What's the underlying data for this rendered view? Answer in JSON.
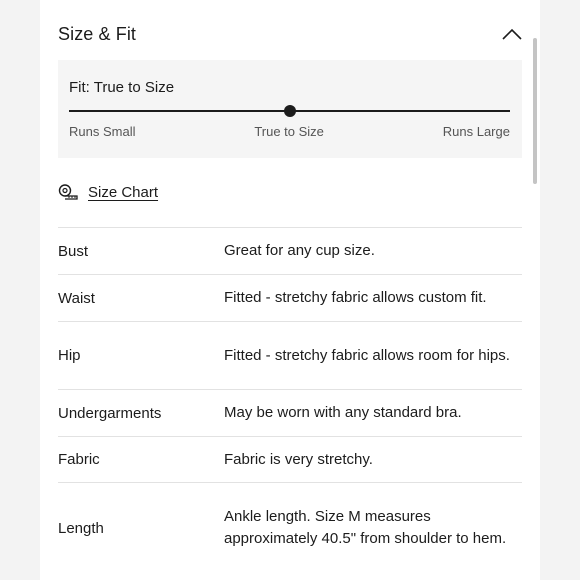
{
  "section": {
    "title": "Size & Fit",
    "collapse_icon": "chevron-up-icon"
  },
  "fit": {
    "title": "Fit: True to Size",
    "level": 0.5,
    "scale": [
      "Runs Small",
      "True to Size",
      "Runs Large"
    ]
  },
  "size_chart": {
    "label": "Size Chart",
    "icon": "measuring-tape-icon"
  },
  "details": [
    {
      "label": "Bust",
      "value": "Great for any cup size."
    },
    {
      "label": "Waist",
      "value": "Fitted - stretchy fabric allows custom fit."
    },
    {
      "label": "Hip",
      "value": "Fitted - stretchy fabric allows room for hips."
    },
    {
      "label": "Undergarments",
      "value": "May be worn with any standard bra."
    },
    {
      "label": "Fabric",
      "value": "Fabric is very stretchy."
    },
    {
      "label": "Length",
      "value": "Ankle length. Size M measures approximately 40.5\" from shoulder to hem."
    }
  ]
}
